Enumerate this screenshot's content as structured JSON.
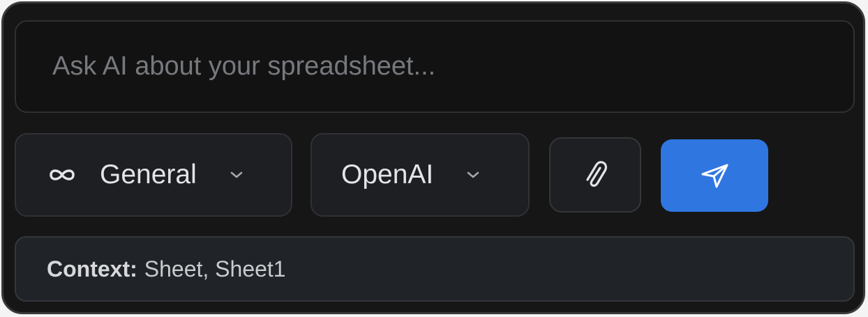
{
  "prompt": {
    "placeholder": "Ask AI about your spreadsheet...",
    "value": ""
  },
  "mode_selector": {
    "icon": "infinity-icon",
    "selected": "General"
  },
  "provider_selector": {
    "selected": "OpenAI"
  },
  "attach_button": {
    "icon": "paperclip-icon"
  },
  "send_button": {
    "icon": "send-icon",
    "color": "#2f76e1"
  },
  "context": {
    "label": "Context:",
    "value": "Sheet, Sheet1"
  }
}
